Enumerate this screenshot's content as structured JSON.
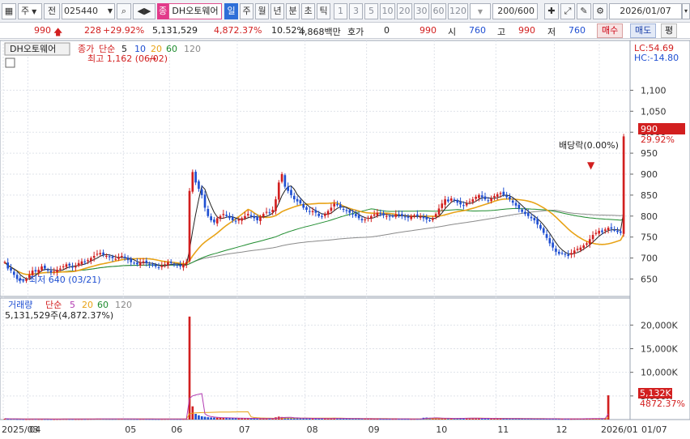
{
  "toolbar": {
    "market": "주",
    "period_type": "전",
    "code": "025440",
    "badge": "종",
    "name": "DH오토웨어",
    "periods": [
      "일",
      "주",
      "월",
      "년",
      "분",
      "초",
      "틱"
    ],
    "intervals": [
      "1",
      "3",
      "5",
      "10",
      "20",
      "30",
      "60",
      "120"
    ],
    "count": "200/600",
    "date": "2026/01/07"
  },
  "info": {
    "price": "990",
    "change": "228",
    "change_pct": "+29.92%",
    "volume": "5,131,529",
    "vol_ratio": "4,872.37%",
    "turnover": "10.52%",
    "amount": "4,868백만",
    "quote_label": "호가",
    "quote_value": "0",
    "quote_price": "990",
    "open_label": "시",
    "open": "760",
    "high_label": "고",
    "high": "990",
    "low_label": "저",
    "low": "760",
    "buy_label": "매수",
    "sell_label": "매도",
    "bal_label": "평"
  },
  "price_panel": {
    "legend_name": "DH오토웨어",
    "legend_close": "종가",
    "legend_type": "단순",
    "ma_periods": [
      "5",
      "10",
      "20",
      "60",
      "120"
    ],
    "max_label": "최고 1,162 (06/02)",
    "min_label": "최저 640 (03/21)",
    "dividend_label": "배당락(0.00%)",
    "lc_label": "LC:54.69",
    "hc_label": "HC:-14.80",
    "current_price": "990",
    "current_pct": "29.92%"
  },
  "volume_panel": {
    "legend_name": "거래량",
    "legend_type": "단순",
    "ma_periods": [
      "5",
      "20",
      "60",
      "120"
    ],
    "value_label": "5,131,529주(4,872.37%)",
    "current_value": "5,132K",
    "current_pct": "4872.37%"
  },
  "chart_data": {
    "type": "candlestick",
    "price_axis": [
      "1,100",
      "1,050",
      "1,000",
      "950",
      "900",
      "850",
      "800",
      "750",
      "700",
      "650"
    ],
    "price_ylim": [
      620,
      1180
    ],
    "volume_axis": [
      "20,000K",
      "15,000K",
      "10,000K",
      "5,000K"
    ],
    "volume_ylim": [
      0,
      24000
    ],
    "x_labels": [
      "2025/03",
      "04",
      "05",
      "06",
      "07",
      "08",
      "09",
      "10",
      "11",
      "12",
      "2026/01",
      "01/07"
    ],
    "closes": [
      690,
      675,
      670,
      660,
      650,
      648,
      645,
      650,
      660,
      670,
      668,
      672,
      680,
      675,
      670,
      665,
      668,
      672,
      675,
      680,
      685,
      682,
      678,
      680,
      688,
      692,
      690,
      695,
      700,
      705,
      710,
      712,
      708,
      705,
      702,
      700,
      698,
      702,
      705,
      700,
      695,
      690,
      688,
      685,
      690,
      692,
      688,
      685,
      682,
      680,
      678,
      682,
      685,
      690,
      688,
      684,
      682,
      680,
      685,
      690,
      860,
      905,
      880,
      865,
      850,
      820,
      800,
      790,
      785,
      795,
      800,
      805,
      800,
      795,
      790,
      788,
      792,
      795,
      800,
      805,
      800,
      795,
      790,
      798,
      805,
      810,
      808,
      815,
      840,
      880,
      900,
      870,
      860,
      850,
      840,
      835,
      830,
      820,
      815,
      810,
      812,
      808,
      800,
      798,
      805,
      812,
      820,
      830,
      826,
      820,
      815,
      812,
      808,
      805,
      800,
      795,
      790,
      792,
      796,
      800,
      804,
      808,
      805,
      802,
      800,
      798,
      800,
      804,
      802,
      800,
      798,
      796,
      800,
      802,
      800,
      798,
      795,
      792,
      790,
      795,
      805,
      818,
      830,
      840,
      835,
      842,
      838,
      832,
      828,
      825,
      830,
      835,
      840,
      846,
      850,
      845,
      840,
      836,
      842,
      848,
      852,
      855,
      850,
      845,
      840,
      832,
      825,
      818,
      810,
      805,
      800,
      795,
      790,
      780,
      770,
      760,
      748,
      735,
      725,
      715,
      710,
      712,
      708,
      705,
      712,
      718,
      722,
      725,
      730,
      735,
      745,
      755,
      760,
      765,
      762,
      768,
      772,
      770,
      766,
      762,
      760,
      990
    ],
    "volumes": [
      180,
      150,
      140,
      160,
      120,
      130,
      110,
      100,
      120,
      130,
      140,
      125,
      110,
      115,
      105,
      100,
      95,
      110,
      120,
      135,
      130,
      125,
      120,
      115,
      118,
      125,
      130,
      140,
      150,
      160,
      170,
      165,
      160,
      150,
      145,
      140,
      150,
      155,
      160,
      150,
      145,
      140,
      135,
      130,
      140,
      145,
      140,
      135,
      130,
      125,
      120,
      130,
      140,
      150,
      145,
      140,
      135,
      130,
      140,
      150,
      21800,
      2800,
      1200,
      900,
      700,
      600,
      500,
      450,
      420,
      400,
      380,
      360,
      340,
      320,
      300,
      290,
      280,
      270,
      260,
      250,
      240,
      230,
      220,
      215,
      210,
      205,
      200,
      195,
      480,
      620,
      540,
      420,
      380,
      350,
      320,
      300,
      280,
      270,
      260,
      250,
      245,
      240,
      235,
      230,
      225,
      220,
      240,
      260,
      250,
      240,
      230,
      220,
      210,
      200,
      195,
      190,
      185,
      180,
      175,
      170,
      165,
      160,
      155,
      150,
      148,
      146,
      150,
      155,
      152,
      148,
      145,
      142,
      140,
      145,
      150,
      160,
      380,
      420,
      360,
      320,
      300,
      280,
      260,
      250,
      240,
      235,
      230,
      260,
      290,
      310,
      300,
      280,
      270,
      260,
      255,
      250,
      245,
      240,
      235,
      230,
      225,
      220,
      215,
      210,
      205,
      200,
      195,
      190,
      185,
      180,
      178,
      176,
      174,
      172,
      170,
      168,
      166,
      164,
      162,
      160,
      158,
      156,
      154,
      152,
      150,
      160,
      170,
      180,
      190,
      200,
      210,
      220,
      230,
      240,
      250,
      260,
      5132
    ]
  },
  "colors": {
    "up": "#d21f1f",
    "down": "#1f4fd2",
    "ma5": "#222222",
    "ma20": "#e8a317",
    "ma60": "#1e8c2e",
    "ma120": "#8a8a8a",
    "vol_ma5": "#b23bb2"
  }
}
